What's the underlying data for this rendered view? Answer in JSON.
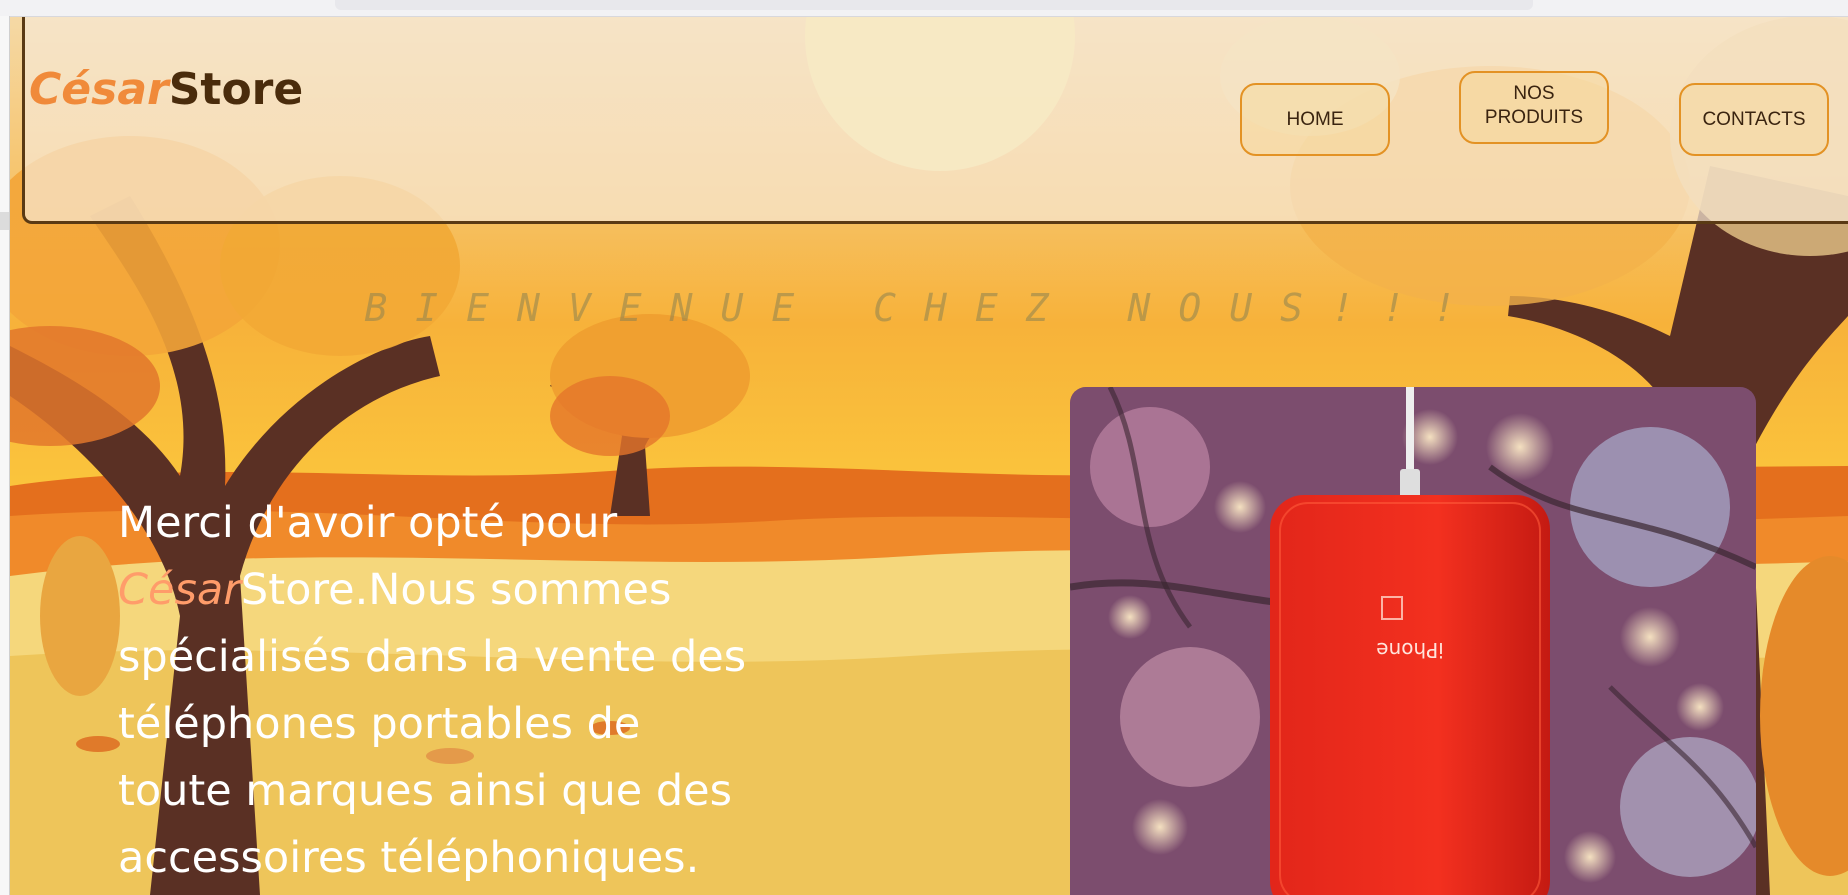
{
  "logo": {
    "part1": "César",
    "part2": "Store"
  },
  "nav": {
    "home": "HOME",
    "produits_line1": "NOS",
    "produits_line2": "PRODUITS",
    "contacts": "CONTACTS"
  },
  "welcome": "BIENVENUE CHEZ NOUS!!!",
  "intro": {
    "line1": "Merci d'avoir opté pour",
    "accent": "César",
    "line2_rest": "Store.Nous sommes",
    "line3": "spécialisés dans la vente des",
    "line4": "téléphones portables de",
    "line5": "toute marques ainsi que des",
    "line6": "accessoires téléphoniques."
  },
  "photo": {
    "phone_label": "iPhone"
  },
  "colors": {
    "accent": "#f08a3a",
    "brand_dark": "#4a2c0c",
    "button_border": "#e39224"
  }
}
